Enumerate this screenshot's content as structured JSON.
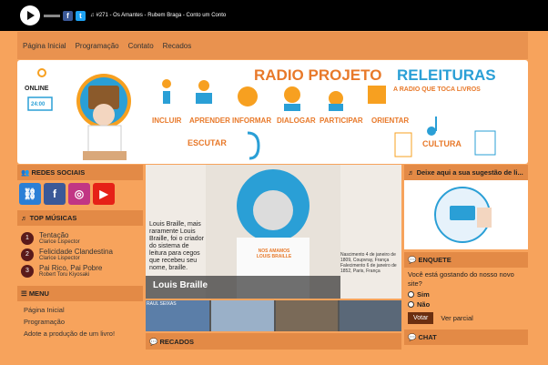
{
  "player": {
    "track": "#271 - Os Amantes - Rubem Braga - Conto um Conto",
    "prefix": "♫"
  },
  "nav": [
    "Página Inicial",
    "Programação",
    "Contato",
    "Recados"
  ],
  "banner": {
    "title1": "RADIO PROJETO",
    "title2": "RELEITURAS",
    "subtitle": "A RADIO QUE TOCA LIVROS",
    "online": "ONLINE",
    "hours": "24:00",
    "words": [
      "INCLUIR",
      "APRENDER",
      "INFORMAR",
      "DIALOGAR",
      "PARTICIPAR",
      "ORIENTAR"
    ],
    "escutar": "ESCUTAR",
    "cultura": "CULTURA"
  },
  "sidebar": {
    "social_title": "REDES SOCIAIS",
    "top_title": "TOP MÚSICAS",
    "tops": [
      {
        "n": "1",
        "title": "Tentação",
        "author": "Clarice Lispector"
      },
      {
        "n": "2",
        "title": "Felicidade Clandestina",
        "author": "Clarice Lispector"
      },
      {
        "n": "3",
        "title": "Pai Rico, Pai Pobre",
        "author": "Robert Toru Kiyosaki"
      }
    ],
    "menu_title": "MENU",
    "menu": [
      "Página Inicial",
      "Programação",
      "Adote a produção de um livro!"
    ]
  },
  "slide": {
    "caption": "Louis Braille",
    "text": "Louis Braille, mais raramente Louis Braille, foi o criador do sistema de leitura para cegos que recebeu seu nome, braille.",
    "shirt": "NOS AMAMOS LOUIS BRAILLE",
    "dates": "Nascimento 4 de janeiro de 1809, Coupvray, França Falecimento 6 de janeiro de 1852, Paris, França",
    "thumb1": "RAUL SEIXAS"
  },
  "recados_title": "RECADOS",
  "right": {
    "sug_title": "Deixe aqui a sua sugestão de li...",
    "enquete_title": "ENQUETE",
    "question": "Você está gostando do nosso novo site?",
    "opt1": "Sim",
    "opt2": "Não",
    "vote": "Votar",
    "results": "Ver parcial",
    "chat_title": "CHAT"
  },
  "colors": {
    "bg": "#f7a35c",
    "header": "#e9924f",
    "title": "#e8792a",
    "accent": "#2a9fd6"
  }
}
